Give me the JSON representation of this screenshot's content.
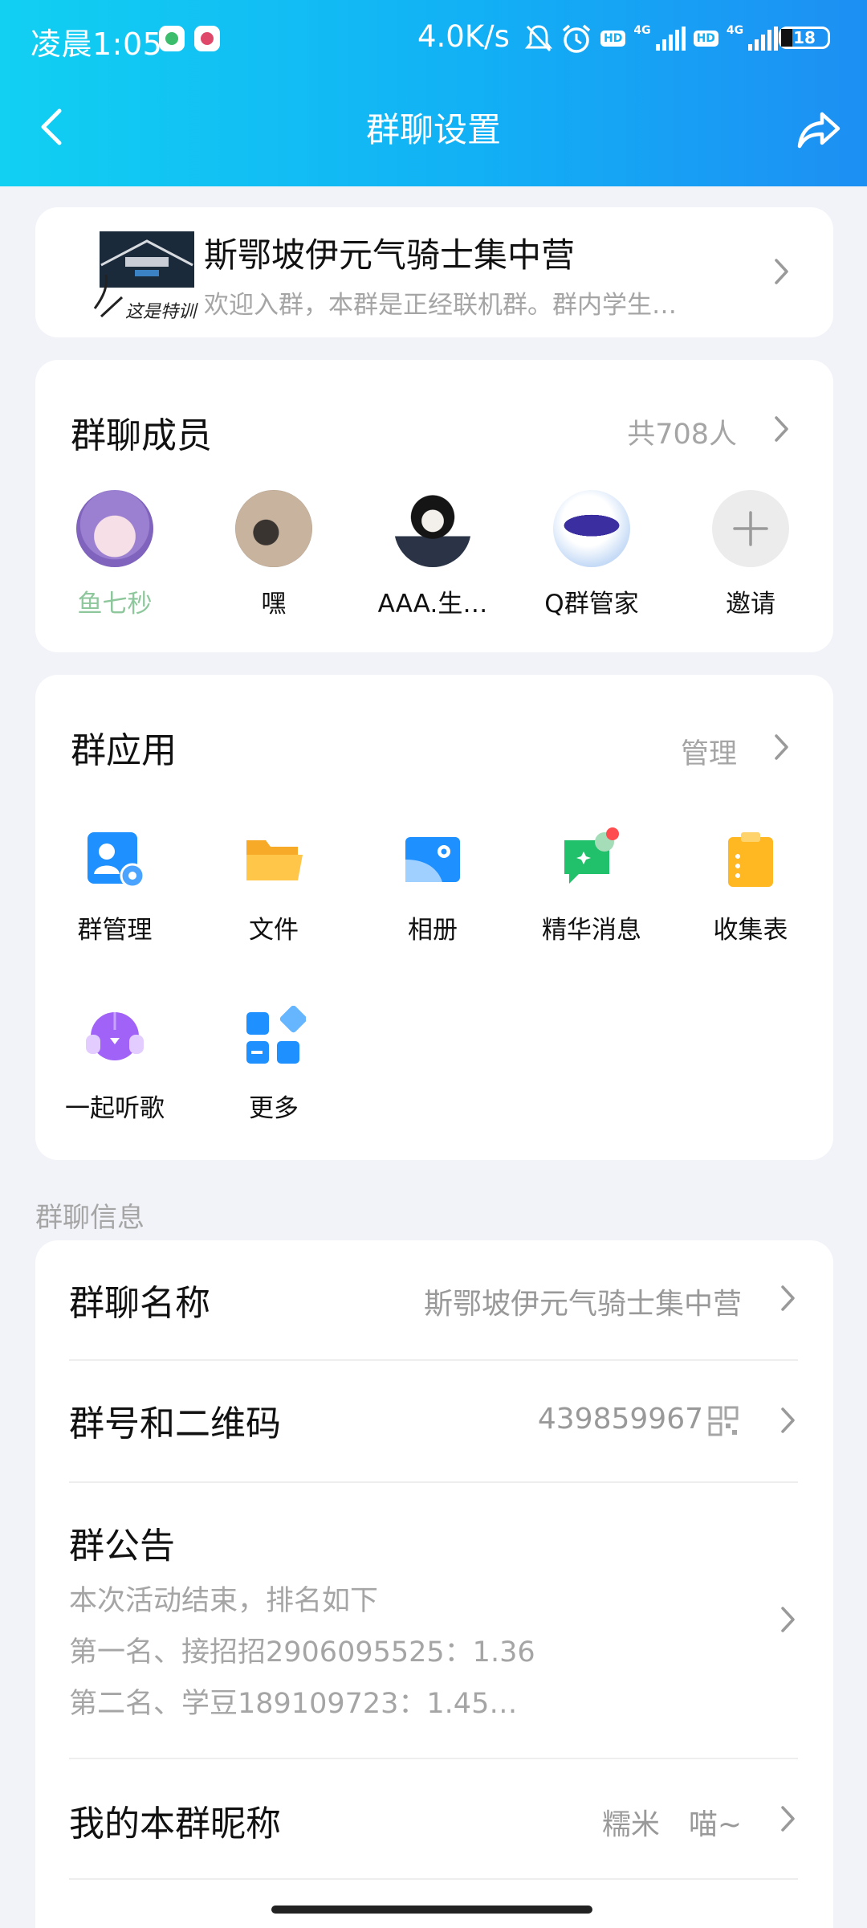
{
  "status_bar": {
    "time": "凌晨1:05",
    "net_speed": "4.0K/s",
    "net_type_1": "4G",
    "net_type_2": "4G",
    "hd_1": "HD",
    "hd_2": "HD",
    "battery": "18"
  },
  "header": {
    "title": "群聊设置",
    "back_icon": "chevron-left-icon",
    "share_icon": "share-forward-icon"
  },
  "group": {
    "name": "斯鄂坡伊元气骑士集中营",
    "description": "欢迎入群，本群是正经联机群。群内学生…",
    "avatar_caption": "这是特训"
  },
  "members": {
    "title": "群聊成员",
    "count": "共708人",
    "list": [
      {
        "name": "鱼七秒"
      },
      {
        "name": "嘿"
      },
      {
        "name": "AAA.生…"
      },
      {
        "name": "Q群管家"
      },
      {
        "name": "邀请"
      }
    ]
  },
  "apps": {
    "title": "群应用",
    "manage": "管理",
    "items": [
      {
        "label": "群管理",
        "icon": "group-manage-icon"
      },
      {
        "label": "文件",
        "icon": "folder-icon"
      },
      {
        "label": "相册",
        "icon": "album-icon"
      },
      {
        "label": "精华消息",
        "icon": "essence-message-icon"
      },
      {
        "label": "收集表",
        "icon": "clipboard-icon"
      },
      {
        "label": "一起听歌",
        "icon": "listen-together-icon"
      },
      {
        "label": "更多",
        "icon": "more-apps-icon"
      }
    ]
  },
  "info": {
    "section_label": "群聊信息",
    "name_label": "群聊名称",
    "name_value": "斯鄂坡伊元气骑士集中营",
    "number_label": "群号和二维码",
    "number_value": "439859967",
    "notice_label": "群公告",
    "notice_lines": [
      "本次活动结束，排名如下",
      "第一名、接招招2906095525：1.36",
      "第二名、学豆189109723：1.45…"
    ],
    "nickname_label": "我的本群昵称",
    "nickname_value": "糯米　喵~"
  },
  "colors": {
    "header_gradient_start": "#11d0f2",
    "header_gradient_end": "#1d8ff3",
    "page_background": "#f2f3f8",
    "secondary_text": "#a5a5a5",
    "accent_blue": "#1e90ff"
  }
}
